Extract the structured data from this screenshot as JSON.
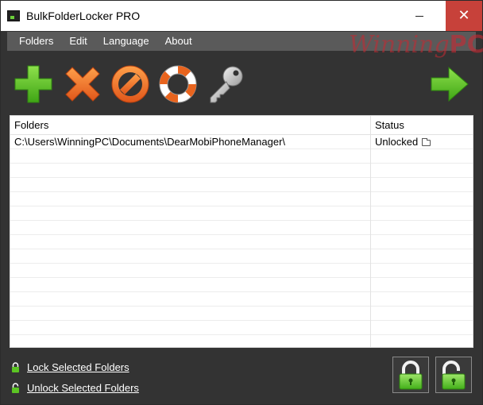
{
  "window": {
    "title": "BulkFolderLocker PRO"
  },
  "menu": [
    {
      "label": "Folders"
    },
    {
      "label": "Edit"
    },
    {
      "label": "Language"
    },
    {
      "label": "About"
    }
  ],
  "watermark": {
    "script": "Winning",
    "bold": "PC"
  },
  "toolbar": [
    {
      "icon": "add-icon",
      "color": "#5cc424"
    },
    {
      "icon": "remove-icon",
      "color": "#e8641e"
    },
    {
      "icon": "block-icon",
      "color": "#e8641e"
    },
    {
      "icon": "lifebuoy-icon",
      "color": "#e8641e"
    },
    {
      "icon": "key-icon",
      "color": "#bdbdbd"
    },
    {
      "icon": "forward-arrow-icon",
      "color": "#5cc424"
    }
  ],
  "grid": {
    "columns": [
      "Folders",
      "Status"
    ],
    "rows": [
      {
        "folder": "C:\\Users\\WinningPC\\Documents\\DearMobiPhoneManager\\",
        "status": "Unlocked"
      }
    ]
  },
  "footer": {
    "lock_label": "Lock Selected Folders",
    "unlock_label": "Unlock Selected Folders"
  },
  "colors": {
    "accent_green": "#5cc424",
    "accent_orange": "#e8641e",
    "background": "#333333",
    "menubar": "#5a5a5a"
  }
}
